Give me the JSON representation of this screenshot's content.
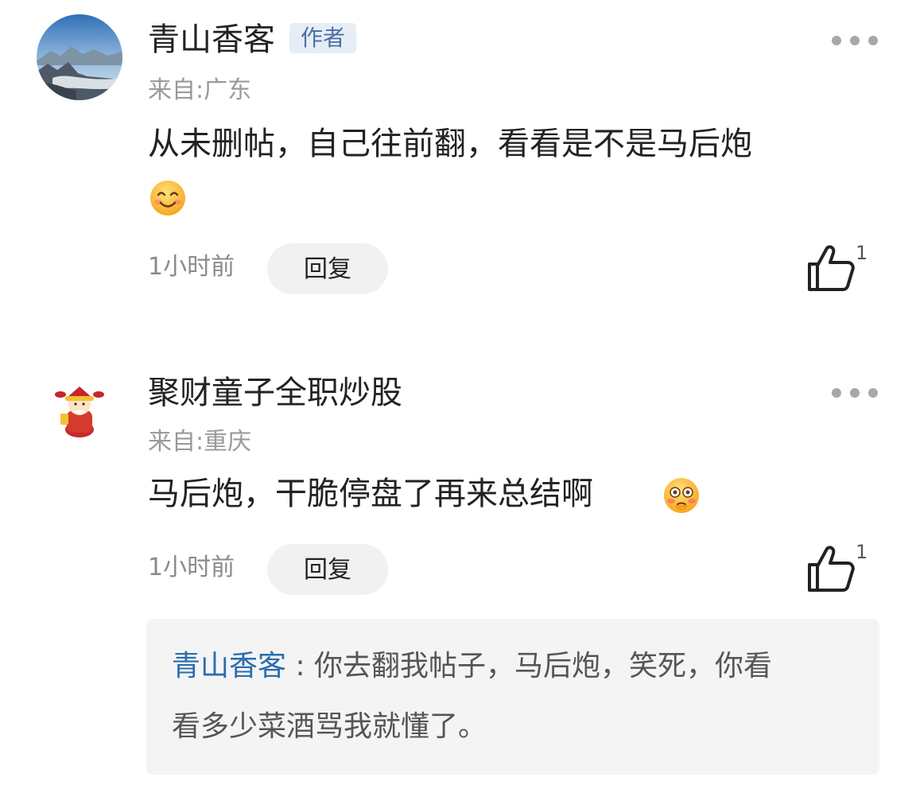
{
  "comments": [
    {
      "username": "青山香客",
      "badge": "作者",
      "location": "来自:广东",
      "text": "从未删帖，自己往前翻，看看是不是马后炮",
      "emoji": "smiling-face-emoji",
      "time": "1小时前",
      "reply_label": "回复",
      "like_count": "1"
    },
    {
      "username": "聚财童子全职炒股",
      "location": "来自:重庆",
      "text": "马后炮，干脆停盘了再来总结啊",
      "emoji": "flushed-face-emoji",
      "time": "1小时前",
      "reply_label": "回复",
      "like_count": "1",
      "sub_reply": {
        "author": "青山香客",
        "separator": " : ",
        "line1": "你去翻我帖子，马后炮，笑死，你看",
        "line2": "看多少菜酒骂我就懂了。"
      }
    }
  ],
  "colors": {
    "badge_text": "#4a6fa5",
    "badge_bg": "#e6edf6",
    "reply_author": "#2a6cb0",
    "quote_bg": "#f4f4f4"
  }
}
